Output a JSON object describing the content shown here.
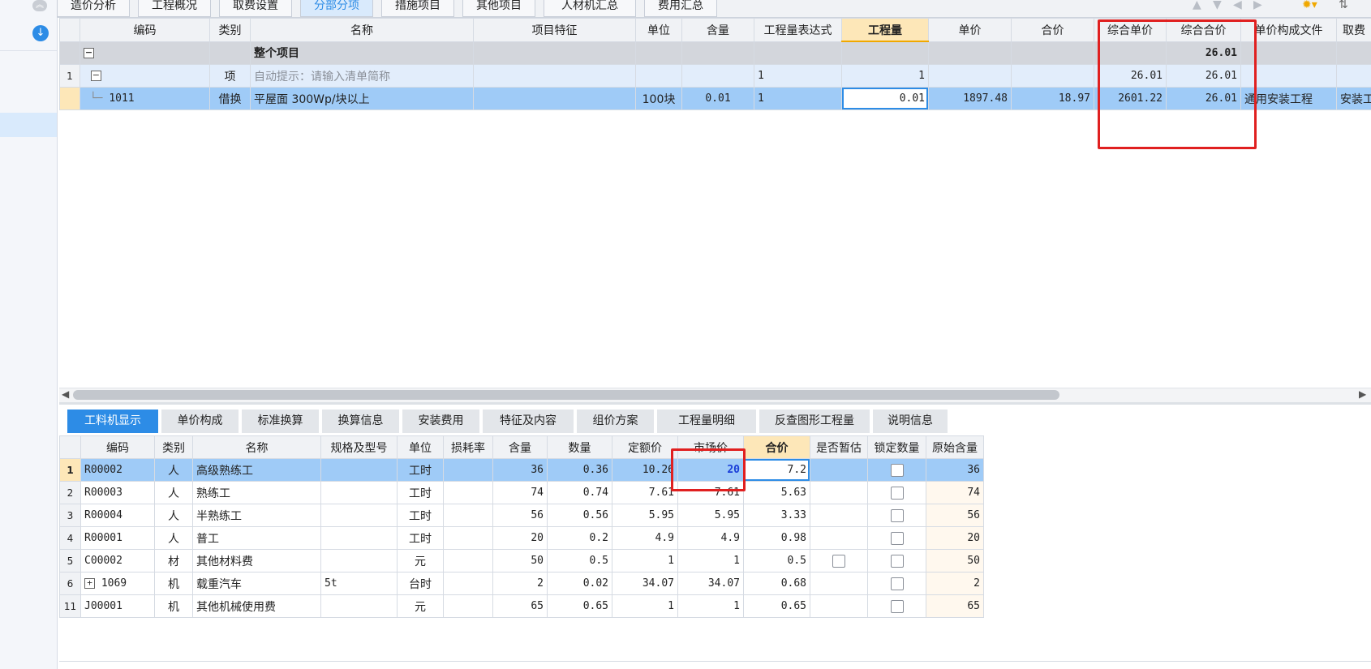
{
  "top_tabs": [
    "造价分析",
    "工程概况",
    "取费设置",
    "分部分项",
    "措施项目",
    "其他项目",
    "人材机汇总",
    "费用汇总"
  ],
  "active_top_tab": "分部分项",
  "upper_grid": {
    "headers": [
      "编码",
      "类别",
      "名称",
      "项目特征",
      "单位",
      "含量",
      "工程量表达式",
      "工程量",
      "单价",
      "合价",
      "综合单价",
      "综合合价",
      "单价构成文件",
      "取费"
    ],
    "total_row": {
      "name": "整个项目",
      "total": "26.01"
    },
    "item_row": {
      "row_no": "1",
      "type": "项",
      "name": "自动提示：请输入清单简称",
      "expr": "1",
      "qty": "1",
      "unit_price_total": "26.01",
      "total": "26.01"
    },
    "sub_row": {
      "code": "1011",
      "type": "借换",
      "name": "平屋面 300Wp/块以上",
      "unit": "100块",
      "content": "0.01",
      "expr": "1",
      "qty": "0.01",
      "price": "1897.48",
      "sum": "18.97",
      "unit_price_total": "2601.22",
      "total": "26.01",
      "template": "通用安装工程",
      "fee": "安装工"
    }
  },
  "bottom_tabs": [
    "工料机显示",
    "单价构成",
    "标准换算",
    "换算信息",
    "安装费用",
    "特征及内容",
    "组价方案",
    "工程量明细",
    "反查图形工程量",
    "说明信息"
  ],
  "active_bottom_tab": "工料机显示",
  "lower_grid": {
    "headers": [
      "编码",
      "类别",
      "名称",
      "规格及型号",
      "单位",
      "损耗率",
      "含量",
      "数量",
      "定额价",
      "市场价",
      "合价",
      "是否暂估",
      "锁定数量",
      "原始含量"
    ],
    "rows": [
      {
        "no": "1",
        "code": "R00002",
        "type": "人",
        "name": "高级熟练工",
        "spec": "",
        "unit": "工时",
        "loss": "",
        "content": "36",
        "qty": "0.36",
        "base_price": "10.26",
        "market_price": "20",
        "sum": "7.2",
        "orig": "36"
      },
      {
        "no": "2",
        "code": "R00003",
        "type": "人",
        "name": "熟练工",
        "spec": "",
        "unit": "工时",
        "loss": "",
        "content": "74",
        "qty": "0.74",
        "base_price": "7.61",
        "market_price": "7.61",
        "sum": "5.63",
        "orig": "74"
      },
      {
        "no": "3",
        "code": "R00004",
        "type": "人",
        "name": "半熟练工",
        "spec": "",
        "unit": "工时",
        "loss": "",
        "content": "56",
        "qty": "0.56",
        "base_price": "5.95",
        "market_price": "5.95",
        "sum": "3.33",
        "orig": "56"
      },
      {
        "no": "4",
        "code": "R00001",
        "type": "人",
        "name": "普工",
        "spec": "",
        "unit": "工时",
        "loss": "",
        "content": "20",
        "qty": "0.2",
        "base_price": "4.9",
        "market_price": "4.9",
        "sum": "0.98",
        "orig": "20"
      },
      {
        "no": "5",
        "code": "C00002",
        "type": "材",
        "name": "其他材料费",
        "spec": "",
        "unit": "元",
        "loss": "",
        "content": "50",
        "qty": "0.5",
        "base_price": "1",
        "market_price": "1",
        "sum": "0.5",
        "orig": "50"
      },
      {
        "no": "6",
        "code": "1069",
        "type": "机",
        "name": "载重汽车",
        "spec": "5t",
        "unit": "台时",
        "loss": "",
        "content": "2",
        "qty": "0.02",
        "base_price": "34.07",
        "market_price": "34.07",
        "sum": "0.68",
        "orig": "2"
      },
      {
        "no": "11",
        "code": "J00001",
        "type": "机",
        "name": "其他机械使用费",
        "spec": "",
        "unit": "元",
        "loss": "",
        "content": "65",
        "qty": "0.65",
        "base_price": "1",
        "market_price": "1",
        "sum": "0.65",
        "orig": "65"
      }
    ]
  },
  "icons": {
    "collapse": "collapse-icon",
    "download": "download-icon",
    "expand": "expand-icon",
    "settings": "settings-icon",
    "sort": "sort-icon"
  },
  "colors": {
    "accent": "#2d8ce6",
    "selected_row": "#9fcbf7",
    "highlight_header": "#fde7b8",
    "annotation": "#e02020"
  }
}
